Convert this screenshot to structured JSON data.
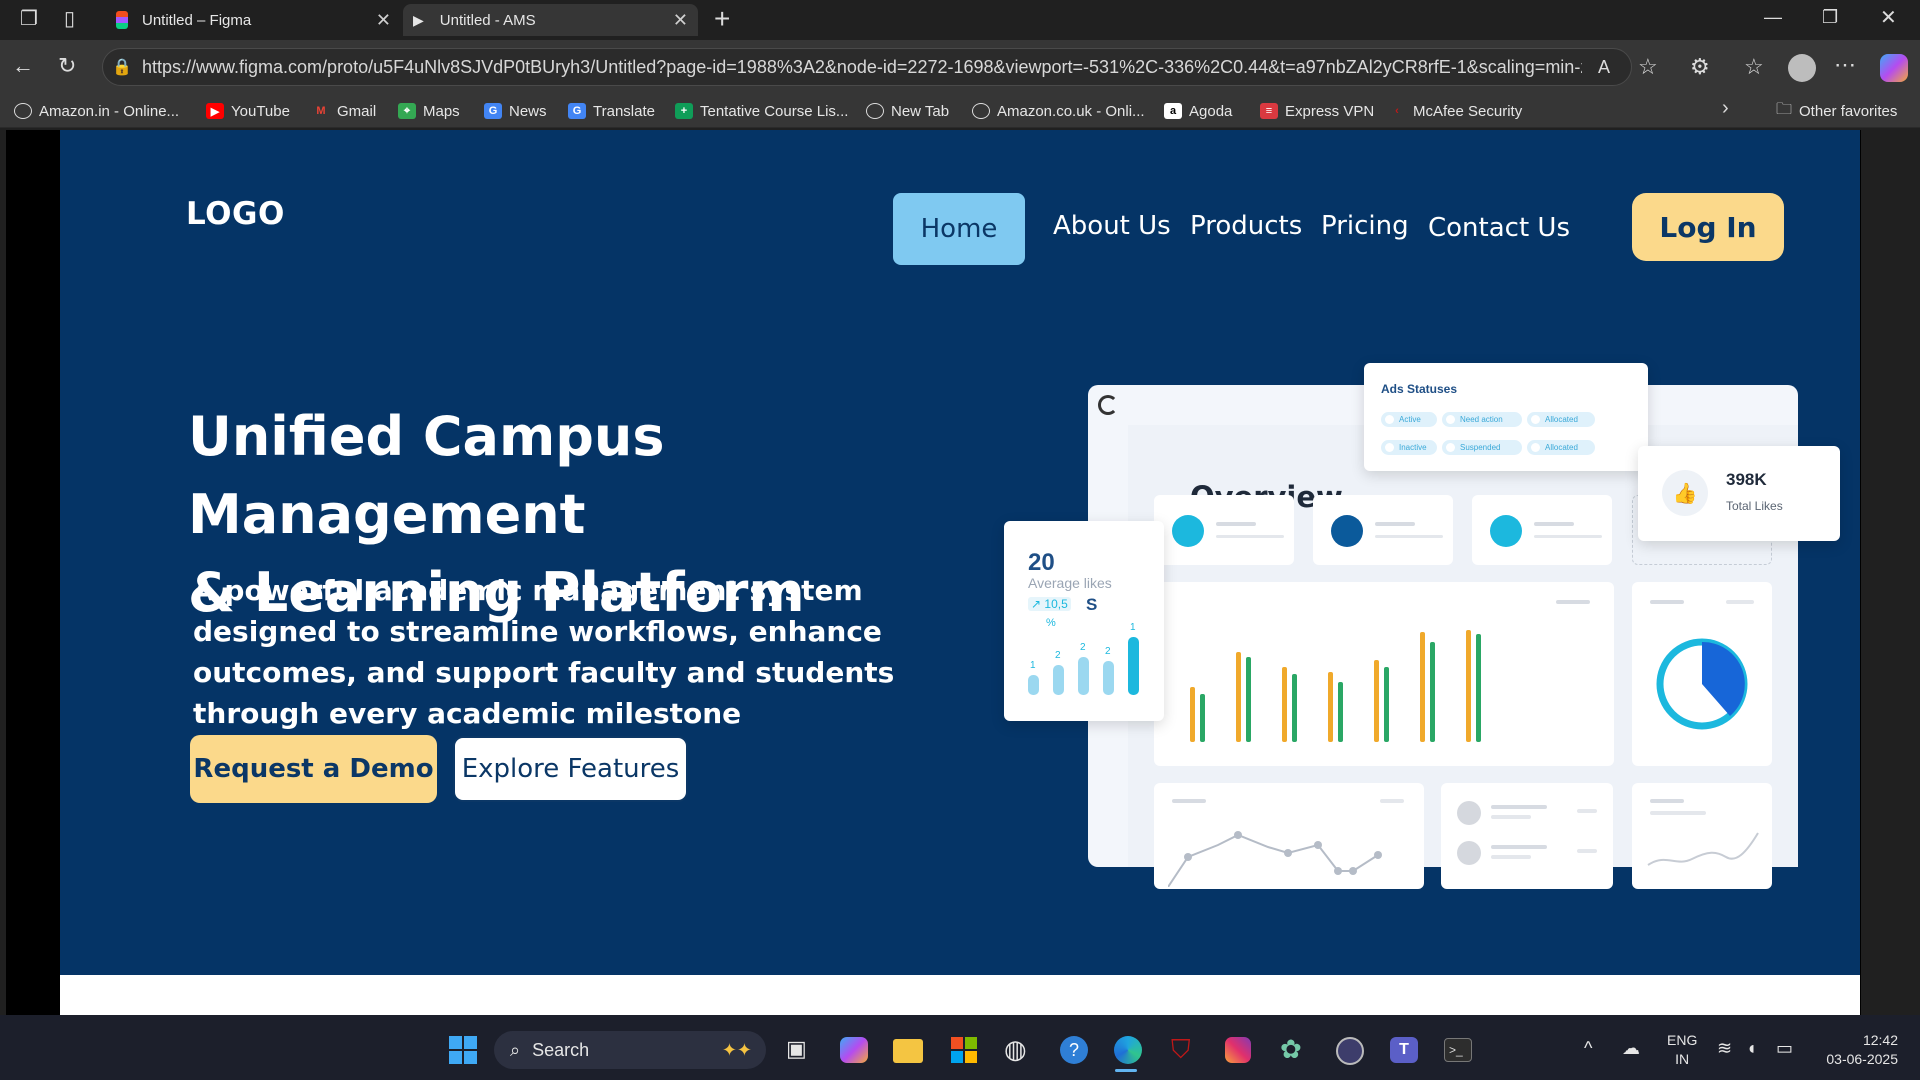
{
  "browser": {
    "tabs": [
      {
        "label": "Untitled – Figma",
        "icon": "figma-icon"
      },
      {
        "label": "Untitled - AMS",
        "icon": "play-icon"
      }
    ],
    "new_tab_label": "+",
    "url": "https://www.figma.com/proto/u5F4uNlv8SJVdP0tBUryh3/Untitled?page-id=1988%3A2&node-id=2272-1698&viewport=-531%2C-336%2C0.44&t=a97nbZAl2yCR8rfE-1&scaling=min-zo...",
    "bookmarks": [
      {
        "label": "Amazon.in - Online...",
        "icon": "globe-icon"
      },
      {
        "label": "YouTube",
        "icon": "youtube-icon",
        "color": "#ff0000"
      },
      {
        "label": "Gmail",
        "icon": "gmail-icon"
      },
      {
        "label": "Maps",
        "icon": "maps-icon"
      },
      {
        "label": "News",
        "icon": "news-icon"
      },
      {
        "label": "Translate",
        "icon": "translate-icon"
      },
      {
        "label": "Tentative Course Lis...",
        "icon": "sheets-icon"
      },
      {
        "label": "New Tab",
        "icon": "globe-icon"
      },
      {
        "label": "Amazon.co.uk - Onli...",
        "icon": "globe-icon"
      },
      {
        "label": "Agoda",
        "icon": "agoda-icon"
      },
      {
        "label": "Express VPN",
        "icon": "expressvpn-icon"
      },
      {
        "label": "McAfee Security",
        "icon": "mcafee-icon"
      }
    ],
    "other_favorites": "Other favorites"
  },
  "site": {
    "logo": "LOGO",
    "nav": [
      "Home",
      "About Us",
      "Products",
      "Pricing",
      "Contact Us"
    ],
    "login": "Log In",
    "headline_line1": "Unified Campus Management",
    "headline_line2": "& Learning Platform",
    "subheading": "A powerful academic management system designed to streamline workflows, enhance outcomes, and support faculty and students through every academic milestone",
    "cta_primary": "Request a Demo",
    "cta_secondary": "Explore Features",
    "colors": {
      "hero_bg": "#053466",
      "accent_yellow": "#fbd98b",
      "accent_blue": "#7fc9f1"
    }
  },
  "dashboard": {
    "overview_title": "Overview",
    "ads_title": "Ads Statuses",
    "ads_pills": [
      "Active",
      "Need action",
      "Allocated",
      "Inactive",
      "Suspended",
      "Allocated"
    ],
    "likes_value": "398K",
    "likes_label": "Total Likes",
    "avg_value": "20",
    "avg_label": "Average likes",
    "avg_change": "10,5",
    "avg_change_unit": "%",
    "avg_suffix": "S",
    "mini_bar_labels": [
      "1",
      "2",
      "2",
      "2",
      "1"
    ]
  },
  "taskbar": {
    "search": "Search",
    "lang_line1": "ENG",
    "lang_line2": "IN",
    "time": "12:42",
    "date": "03-06-2025"
  }
}
